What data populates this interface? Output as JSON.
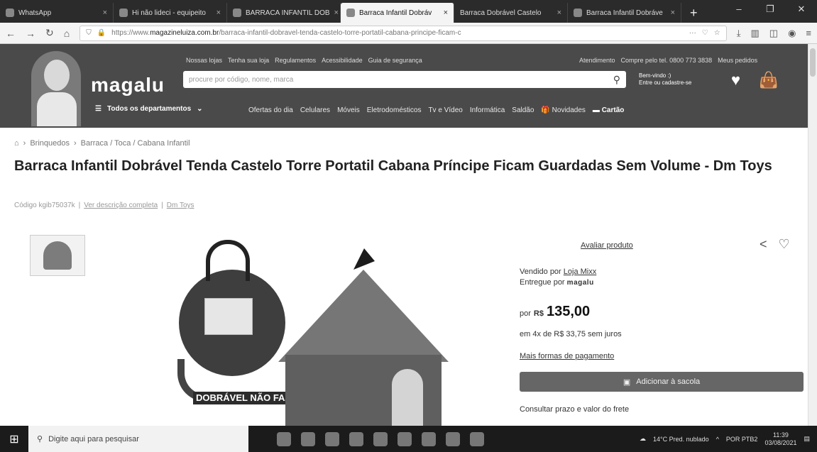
{
  "browser": {
    "tabs": [
      {
        "label": "WhatsApp",
        "active": false
      },
      {
        "label": "Hi não lideci - equipeito",
        "active": false
      },
      {
        "label": "BARRACA INFANTIL DOB",
        "active": false
      },
      {
        "label": "Barraca Infantil Dobráv",
        "active": true
      },
      {
        "label": "Barraca Dobrável Castelo",
        "active": false
      },
      {
        "label": "Barraca Infantil Dobráve",
        "active": false
      }
    ],
    "url_prefix": "https://www.",
    "url_domain": "magazineluiza.com.br",
    "url_path": "/barraca-infantil-dobravel-tenda-castelo-torre-portatil-cabana-principe-ficam-c"
  },
  "header": {
    "logo": "magalu",
    "top_links": [
      "Nossas lojas",
      "Tenha sua loja",
      "Regulamentos",
      "Acessibilidade",
      "Guia de segurança"
    ],
    "top_links_right": [
      "Atendimento",
      "Compre pelo tel. 0800 773 3838",
      "Meus pedidos"
    ],
    "search_placeholder": "procure por código, nome, marca",
    "welcome_line1": "Bem-vindo :)",
    "welcome_line2": "Entre ou cadastre-se",
    "departments_label": "Todos os departamentos",
    "menu": [
      "Ofertas do dia",
      "Celulares",
      "Móveis",
      "Eletrodomésticos",
      "Tv e Vídeo",
      "Informática",
      "Saldão",
      "Novidades",
      "Cartão"
    ]
  },
  "breadcrumb": [
    "Brinquedos",
    "Barraca / Toca / Cabana Infantil"
  ],
  "product": {
    "title": "Barraca Infantil Dobrável Tenda Castelo Torre Portatil Cabana Príncipe Ficam Guardadas Sem Volume - Dm Toys",
    "code": "Código kgib75037k",
    "description_link": "Ver descrição completa",
    "brand_link": "Dm Toys",
    "image_caption": "DOBRÁVEL NÃO FAZ VOLUME"
  },
  "buybox": {
    "rate_link": "Avaliar produto",
    "sold_by_label": "Vendido por",
    "sold_by": "Loja Mixx",
    "delivered_by_label": "Entregue por",
    "delivered_by": "magalu",
    "price_prefix": "por",
    "currency": "R$",
    "price": "135,00",
    "installments": "em 4x de R$ 33,75 sem juros",
    "more_payment": "Mais formas de pagamento",
    "add_to_bag": "Adicionar à sacola",
    "shipping": "Consultar prazo e valor do frete"
  },
  "taskbar": {
    "search_placeholder": "Digite aqui para pesquisar",
    "weather": "14°C Pred. nublado",
    "lang": "POR PTB2",
    "time": "11:39",
    "date": "03/08/2021"
  }
}
